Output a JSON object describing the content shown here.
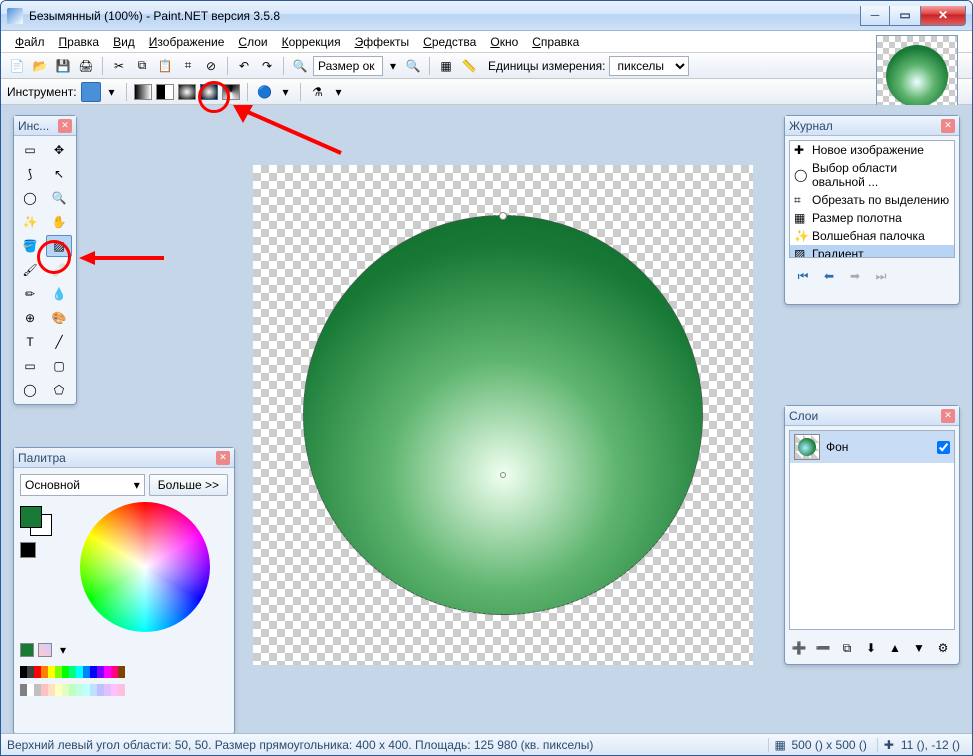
{
  "titlebar": {
    "title": "Безымянный (100%) - Paint.NET версия 3.5.8"
  },
  "menu": {
    "file": "Файл",
    "edit": "Правка",
    "view": "Вид",
    "image": "Изображение",
    "layers": "Слои",
    "adjust": "Коррекция",
    "effects": "Эффекты",
    "tools": "Средства",
    "window": "Окно",
    "help": "Справка"
  },
  "toolbar": {
    "size_label": "Размер ок",
    "units_label": "Единицы измерения:",
    "units_value": "пикселы"
  },
  "toolbar2": {
    "label": "Инструмент:"
  },
  "tools_panel": {
    "title": "Инс..."
  },
  "palette": {
    "title": "Палитра",
    "mode": "Основной",
    "more": "Больше >>",
    "colors": [
      "#000000",
      "#404040",
      "#ff0000",
      "#ff8000",
      "#ffff00",
      "#80ff00",
      "#00ff00",
      "#00ff80",
      "#00ffff",
      "#0080ff",
      "#0000ff",
      "#8000ff",
      "#ff00ff",
      "#ff0080",
      "#804000",
      "#808080",
      "#ffffff",
      "#c0c0c0",
      "#ffc0c0",
      "#ffe0c0",
      "#ffffc0",
      "#e0ffc0",
      "#c0ffc0",
      "#c0ffe0",
      "#c0ffff",
      "#c0e0ff",
      "#c0c0ff",
      "#e0c0ff",
      "#ffc0ff",
      "#ffc0e0"
    ]
  },
  "history": {
    "title": "Журнал",
    "items": [
      {
        "icon": "new",
        "label": "Новое изображение"
      },
      {
        "icon": "ellipse",
        "label": "Выбор области овальной ..."
      },
      {
        "icon": "crop",
        "label": "Обрезать по выделению"
      },
      {
        "icon": "canvas",
        "label": "Размер полотна"
      },
      {
        "icon": "wand",
        "label": "Волшебная палочка"
      },
      {
        "icon": "gradient",
        "label": "Градиент"
      }
    ]
  },
  "layers": {
    "title": "Слои",
    "bg": "Фон"
  },
  "status": {
    "left": "Верхний левый угол области: 50, 50. Размер прямоугольника: 400 x 400. Площадь: 125 980 (кв. пикселы)",
    "canvas": "500 () x 500 ()",
    "cursor": "11 (), -12 ()"
  }
}
